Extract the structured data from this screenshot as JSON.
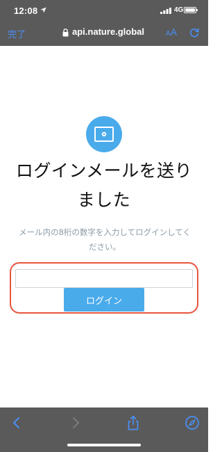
{
  "status_bar": {
    "time": "12:08",
    "network": "4G",
    "icons": [
      "location-arrow-icon",
      "signal-icon",
      "battery-icon"
    ]
  },
  "browser_bar": {
    "done_label": "完了",
    "url": "api.nature.global",
    "text_size_small": "A",
    "text_size_large": "A",
    "icons": [
      "lock-icon",
      "reload-icon"
    ]
  },
  "page": {
    "icon": "mail-icon",
    "title_line1": "ログインメールを送り",
    "title_line2": "ました",
    "description": "メール内の8桁の数字を入力してログインしてください。",
    "code_input_value": "",
    "code_input_placeholder": "",
    "login_button_label": "ログイン"
  },
  "toolbar": {
    "icons": [
      "back-icon",
      "forward-icon",
      "share-icon",
      "safari-compass-icon"
    ]
  },
  "colors": {
    "chrome_background": "#5a5a5a",
    "ios_link_blue": "#4a8ff5",
    "brand_blue": "#4aabeb",
    "highlight_red": "#e8553c",
    "description_gray": "#8a9aa6"
  }
}
